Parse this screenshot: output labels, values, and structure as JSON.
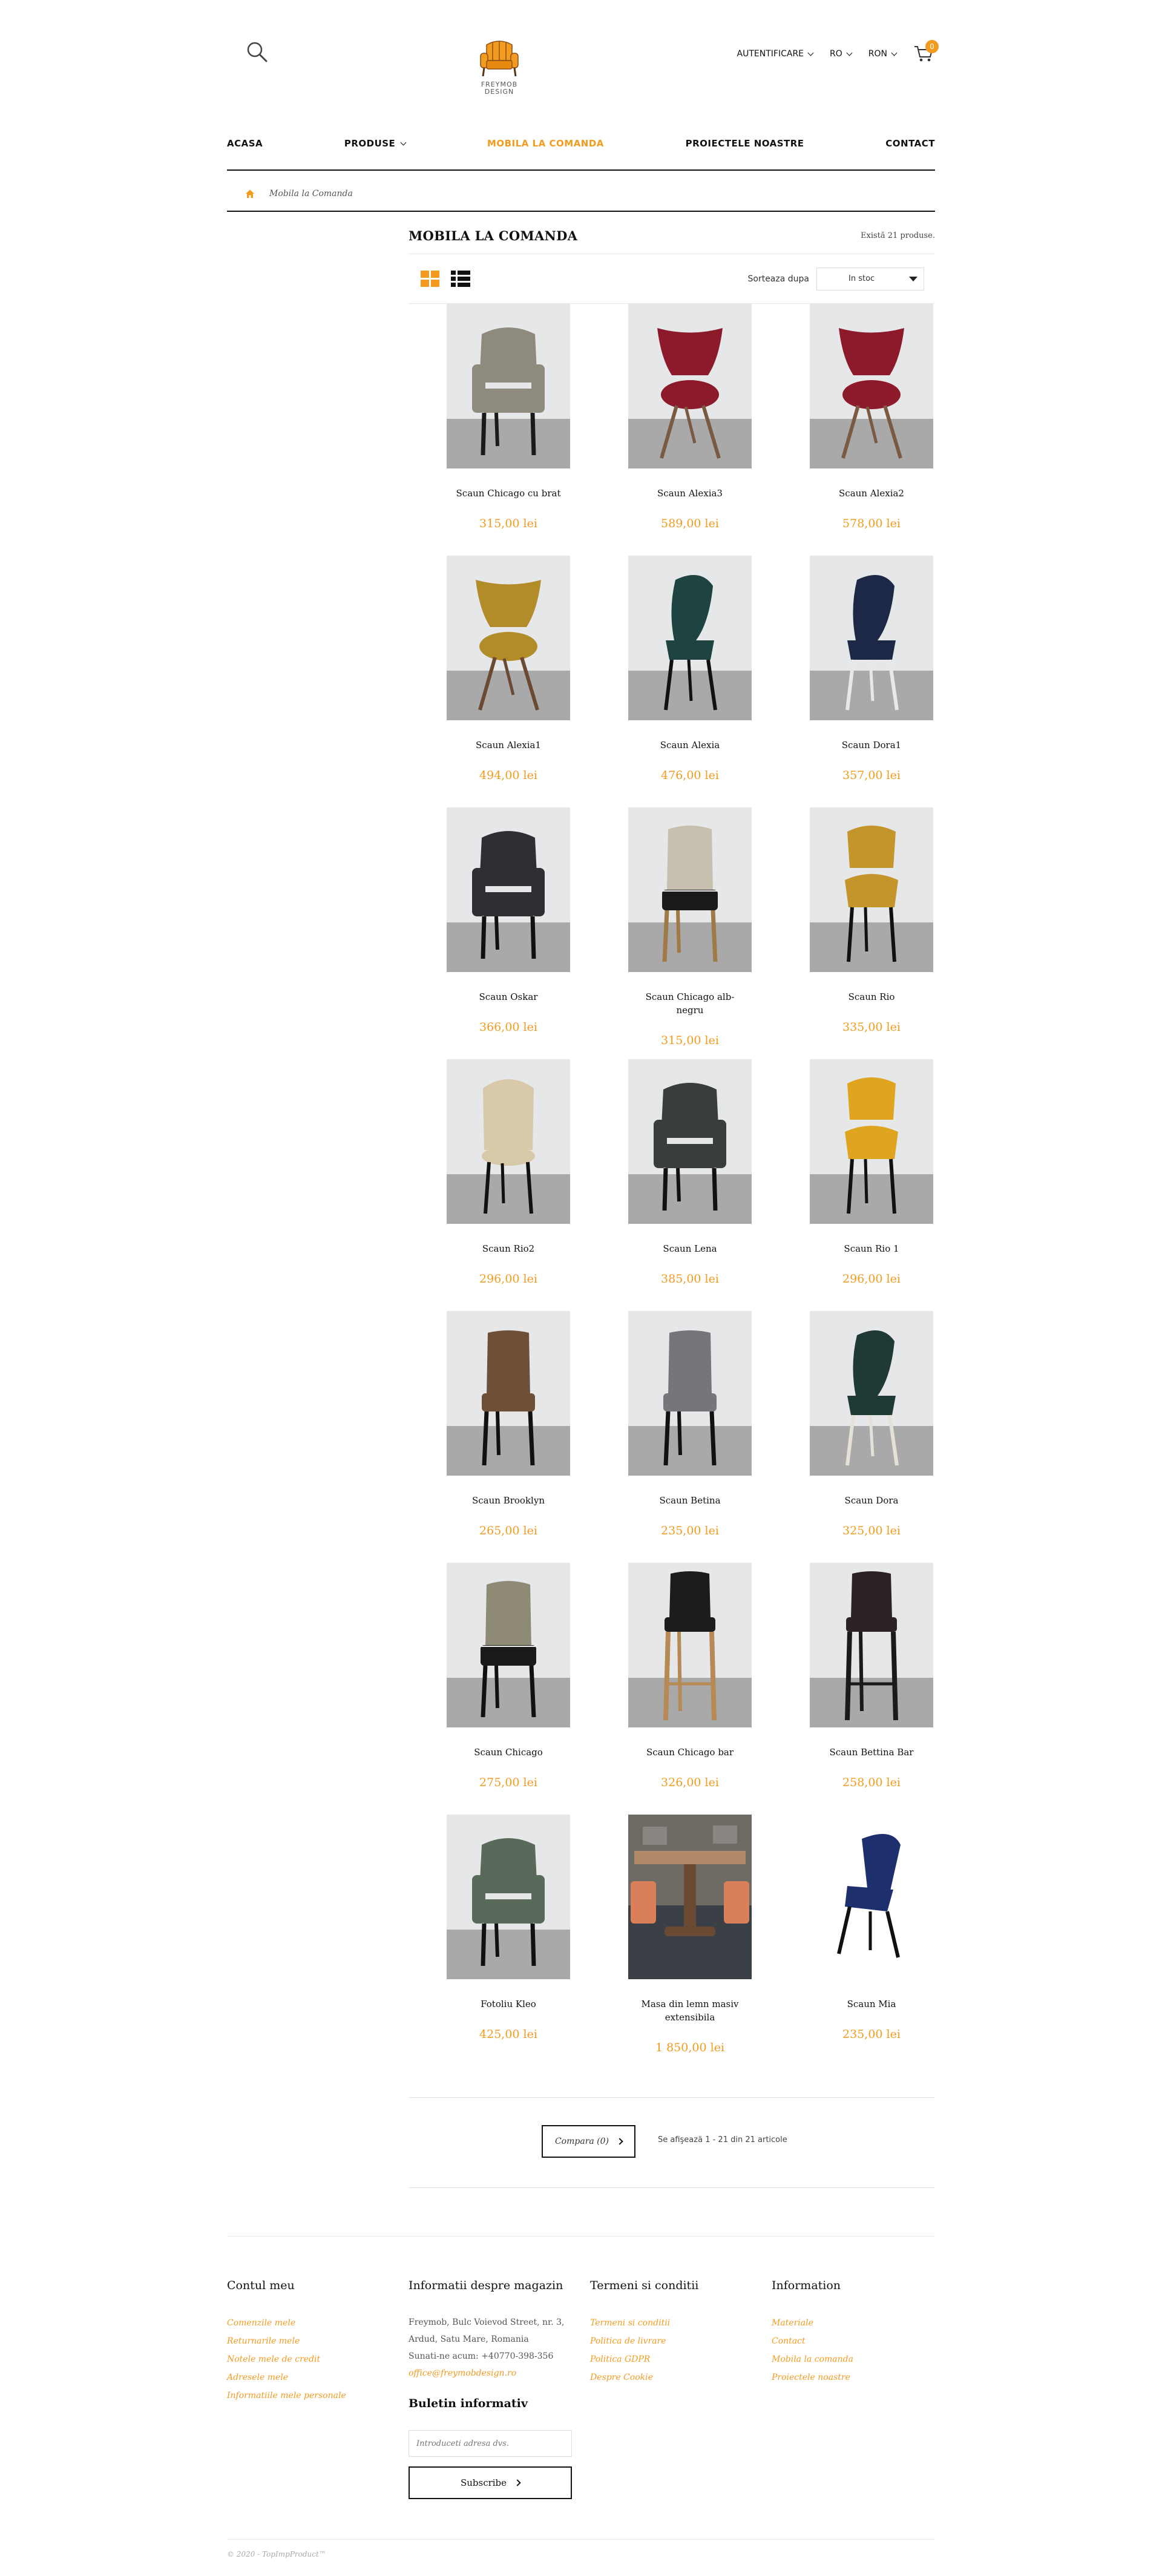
{
  "header": {
    "logo_text_top": "FREYMOB",
    "logo_text_bottom": "DESIGN",
    "account_label": "AUTENTIFICARE",
    "language_label": "RO",
    "currency_label": "RON",
    "cart_count": "0"
  },
  "nav": {
    "items": [
      {
        "label": "ACASA"
      },
      {
        "label": "PRODUSE"
      },
      {
        "label": "MOBILA LA COMANDA"
      },
      {
        "label": "PROIECTELE NOASTRE"
      },
      {
        "label": "CONTACT"
      }
    ]
  },
  "breadcrumb": {
    "current": "Mobila la Comanda"
  },
  "main": {
    "title": "MOBILA LA COMANDA",
    "product_count": "Există 21 produse.",
    "sort_label": "Sorteaza dupa",
    "sort_value": "In stoc"
  },
  "products": [
    {
      "name": "Scaun Chicago cu brat",
      "price": "315,00 lei",
      "color": "#8f8a7e",
      "leg": "#1a1a1a",
      "shape": "arm"
    },
    {
      "name": "Scaun Alexia3",
      "price": "589,00 lei",
      "color": "#8c1a2a",
      "leg": "#7a5a42",
      "shape": "wing"
    },
    {
      "name": "Scaun Alexia2",
      "price": "578,00 lei",
      "color": "#8c1a2a",
      "leg": "#7a5a42",
      "shape": "wing"
    },
    {
      "name": "Scaun Alexia1",
      "price": "494,00 lei",
      "color": "#b38c2a",
      "leg": "#6b4a33",
      "shape": "wing"
    },
    {
      "name": "Scaun Alexia",
      "price": "476,00 lei",
      "color": "#1d4440",
      "leg": "#111111",
      "shape": "curve"
    },
    {
      "name": "Scaun Dora1",
      "price": "357,00 lei",
      "color": "#1c2845",
      "leg": "#e8e8e8",
      "shape": "curve"
    },
    {
      "name": "Scaun Oskar",
      "price": "366,00 lei",
      "color": "#2f2f33",
      "leg": "#111111",
      "shape": "arm"
    },
    {
      "name": "Scaun Chicago alb-negru",
      "price": "315,00 lei",
      "color": "#c7bfae",
      "leg": "#a07a45",
      "shape": "duo"
    },
    {
      "name": "Scaun Rio",
      "price": "335,00 lei",
      "color": "#c3952a",
      "leg": "#111111",
      "shape": "open"
    },
    {
      "name": "Scaun Rio2",
      "price": "296,00 lei",
      "color": "#d8c9a8",
      "leg": "#111111",
      "shape": "tub"
    },
    {
      "name": "Scaun Lena",
      "price": "385,00 lei",
      "color": "#3a3d3d",
      "leg": "#111111",
      "shape": "arm"
    },
    {
      "name": "Scaun Rio 1",
      "price": "296,00 lei",
      "color": "#e0a520",
      "leg": "#111111",
      "shape": "open"
    },
    {
      "name": "Scaun Brooklyn",
      "price": "265,00 lei",
      "color": "#6e5038",
      "leg": "#111111",
      "shape": "tall"
    },
    {
      "name": "Scaun Betina",
      "price": "235,00 lei",
      "color": "#77757a",
      "leg": "#111111",
      "shape": "tall"
    },
    {
      "name": "Scaun Dora",
      "price": "325,00 lei",
      "color": "#1f3a35",
      "leg": "#e5e0d8",
      "shape": "curve"
    },
    {
      "name": "Scaun Chicago",
      "price": "275,00 lei",
      "color": "#8f8a76",
      "leg": "#111111",
      "shape": "duo"
    },
    {
      "name": "Scaun Chicago bar",
      "price": "326,00 lei",
      "color": "#1c1c1c",
      "leg": "#b58a55",
      "shape": "bar"
    },
    {
      "name": "Scaun Bettina Bar",
      "price": "258,00 lei",
      "color": "#2a2226",
      "leg": "#1a1a1a",
      "shape": "bar"
    },
    {
      "name": "Fotoliu Kleo",
      "price": "425,00 lei",
      "color": "#5a6a5a",
      "leg": "#111111",
      "shape": "arm"
    },
    {
      "name": "Masa din lemn masiv extensibila",
      "price": "1 850,00 lei",
      "color": "#b08a68",
      "leg": "#6b4a33",
      "shape": "table"
    },
    {
      "name": "Scaun Mia",
      "price": "235,00 lei",
      "color": "#1e2f6e",
      "leg": "#111111",
      "shape": "mia"
    }
  ],
  "pager": {
    "compare_label": "Compara (0)",
    "info": "Se afişează 1 - 21 din 21 articole"
  },
  "footer": {
    "account": {
      "title": "Contul meu",
      "links": [
        "Comenzile mele",
        "Returnarile mele",
        "Notele mele de credit",
        "Adresele mele",
        "Informatiile mele personale"
      ]
    },
    "store": {
      "title": "Informatii despre magazin",
      "lines": [
        "Freymob, Bulc Voievod Street, nr. 3,",
        "Ardud, Satu Mare, Romania",
        "Sunati-ne acum: +40770-398-356"
      ],
      "email": "office@freymobdesign.ro"
    },
    "terms": {
      "title": "Termeni si conditii",
      "links": [
        "Termeni si conditii",
        "Politica de livrare",
        "Politica GDPR",
        "Despre Cookie"
      ]
    },
    "info": {
      "title": "Information",
      "links": [
        "Materiale",
        "Contact",
        "Mobila la comanda",
        "Proiectele noastre"
      ]
    },
    "newsletter": {
      "title": "Buletin informativ",
      "placeholder": "Introduceti adresa dvs.",
      "button": "Subscribe"
    },
    "copyright": "© 2020 - TopImpProduct™"
  },
  "colors": {
    "accent": "#f39b1f",
    "text": "#111111",
    "rule": "#111111"
  }
}
